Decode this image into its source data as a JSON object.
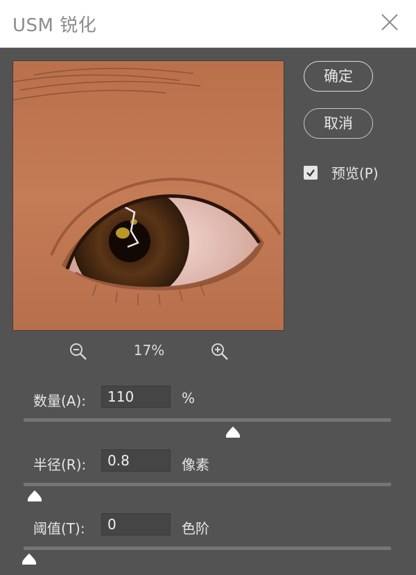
{
  "window": {
    "title": "USM 锐化"
  },
  "buttons": {
    "ok_label": "确定",
    "cancel_label": "取消"
  },
  "preview_checkbox": {
    "label": "预览(P)",
    "checked": true
  },
  "zoom": {
    "level": "17%"
  },
  "params": {
    "amount": {
      "label": "数量(A):",
      "value": "110",
      "unit": "%",
      "slider_fraction": 0.57
    },
    "radius": {
      "label": "半径(R):",
      "value": "0.8",
      "unit": "像素",
      "slider_fraction": 0.03
    },
    "threshold": {
      "label": "阈值(T):",
      "value": "0",
      "unit": "色阶",
      "slider_fraction": 0.0
    }
  },
  "colors": {
    "dialog_bg": "#535353",
    "titlebar_bg": "#ffffff",
    "title_text": "#8c8c8c",
    "slider_track": "#757575",
    "input_bg": "#454545"
  },
  "icons": {
    "close": "close-icon",
    "zoom_out": "zoom-out-icon",
    "zoom_in": "zoom-in-icon",
    "check": "checkmark-icon"
  }
}
